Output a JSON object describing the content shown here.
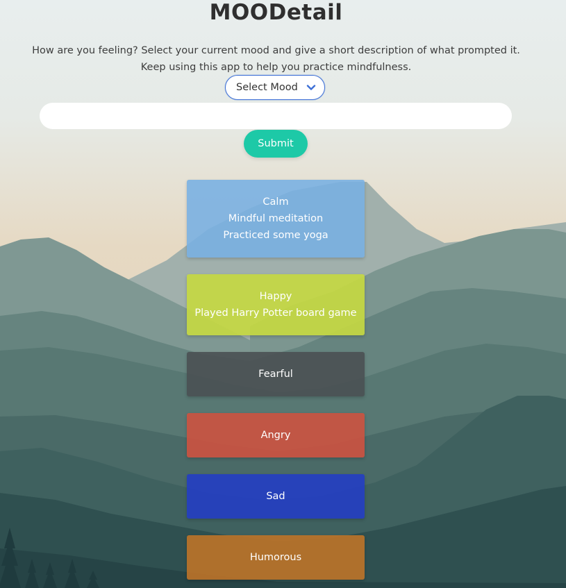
{
  "header": {
    "title": "MOODetail",
    "intro_line1": "How are you feeling? Select your current mood and give a short description of what prompted it.",
    "intro_line2": "Keep using this app to help you practice mindfulness."
  },
  "form": {
    "mood_select": {
      "selected": "Select Mood",
      "icon": "chevron-down-icon",
      "border_color": "#3d6fd6"
    },
    "description_input": {
      "value": "",
      "placeholder": ""
    },
    "submit_label": "Submit",
    "submit_color": "#1dc9a7"
  },
  "moods": [
    {
      "mood": "Calm",
      "lines": [
        "Mindful meditation",
        "Practiced some yoga"
      ],
      "color": "#78afe2"
    },
    {
      "mood": "Happy",
      "lines": [
        "Played Harry Potter board game"
      ],
      "color": "#c1d547"
    },
    {
      "mood": "Fearful",
      "lines": [],
      "color": "#4d5356"
    },
    {
      "mood": "Angry",
      "lines": [],
      "color": "#c75443"
    },
    {
      "mood": "Sad",
      "lines": [],
      "color": "#233fc0"
    },
    {
      "mood": "Humorous",
      "lines": [],
      "color": "#b97329"
    }
  ],
  "background": {
    "sky_top": "#e8eeee",
    "sky_bottom": "#e7d7bf",
    "mountain_colors": [
      "#a2b1ae",
      "#7d9893",
      "#62827e",
      "#4e6f6c",
      "#3b5c5b",
      "#2a4a4b"
    ]
  }
}
